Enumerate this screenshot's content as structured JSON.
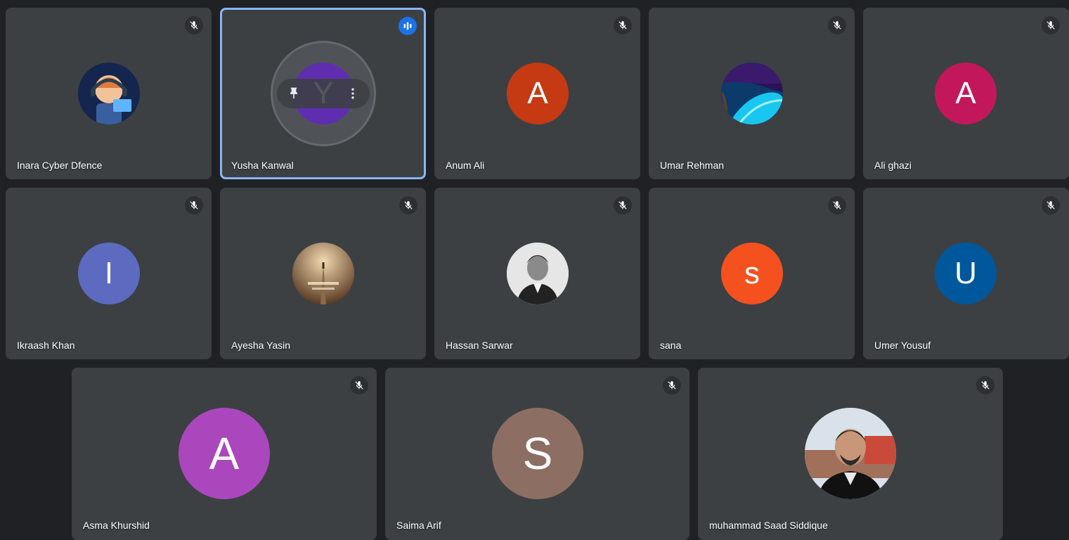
{
  "participants": [
    {
      "name": "Inara Cyber Dfence",
      "initial": "",
      "avatar_type": "cartoon-photo",
      "color": "#1b3a6b",
      "muted": true
    },
    {
      "name": "Yusha Kanwal",
      "initial": "Y",
      "avatar_type": "letter",
      "color": "#5f2eb0",
      "muted": false,
      "speaking": true
    },
    {
      "name": "Anum Ali",
      "initial": "A",
      "avatar_type": "letter",
      "color": "#c53a13",
      "muted": true
    },
    {
      "name": "Umar Rehman",
      "initial": "",
      "avatar_type": "night-beach-photo",
      "color": "#1a1040",
      "muted": true
    },
    {
      "name": "Ali ghazi",
      "initial": "A",
      "avatar_type": "letter",
      "color": "#c2185b",
      "muted": true
    },
    {
      "name": "Ikraash Khan",
      "initial": "I",
      "avatar_type": "letter",
      "color": "#5c6bc0",
      "muted": true
    },
    {
      "name": "Ayesha Yasin",
      "initial": "",
      "avatar_type": "foggy-road-photo",
      "color": "#6b4a2e",
      "muted": true
    },
    {
      "name": "Hassan Sarwar",
      "initial": "",
      "avatar_type": "portrait-photo",
      "color": "#d8d8d8",
      "muted": true
    },
    {
      "name": "sana",
      "initial": "s",
      "avatar_type": "letter",
      "color": "#f4511e",
      "muted": true
    },
    {
      "name": "Umer Yousuf",
      "initial": "U",
      "avatar_type": "letter",
      "color": "#01579b",
      "muted": true
    },
    {
      "name": "Asma Khurshid",
      "initial": "A",
      "avatar_type": "letter",
      "color": "#ab47bc",
      "muted": true
    },
    {
      "name": "Saima Arif",
      "initial": "S",
      "avatar_type": "letter",
      "color": "#8d6e63",
      "muted": true
    },
    {
      "name": "muhammad Saad Siddique",
      "initial": "",
      "avatar_type": "portrait-photo",
      "color": "#c8c4bc",
      "muted": true
    }
  ],
  "icons": {
    "mic_off": "mic-off-icon",
    "speaking": "audio-level-icon",
    "pin": "pin-icon",
    "more": "more-vert-icon"
  },
  "colors": {
    "background": "#202124",
    "tile": "#3c4043",
    "speaking_border": "#8ab4f8",
    "speaking_badge": "#1a73e8"
  }
}
